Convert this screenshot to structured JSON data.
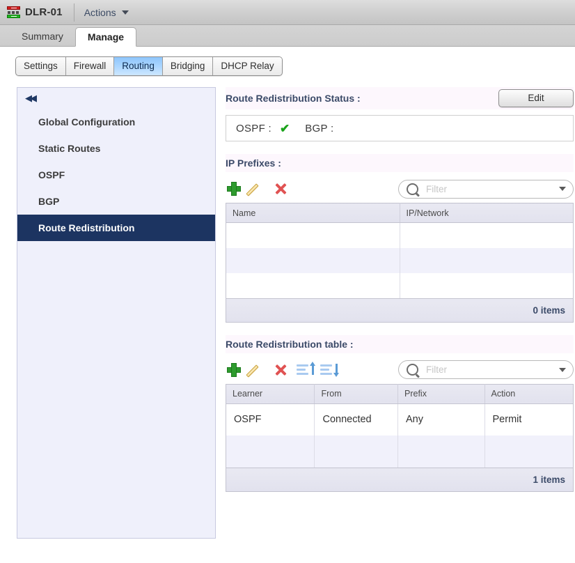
{
  "object_bar": {
    "icon": "router-device-icon",
    "title": "DLR-01",
    "actions_label": "Actions"
  },
  "main_tabs": [
    {
      "label": "Summary",
      "active": false
    },
    {
      "label": "Manage",
      "active": true
    }
  ],
  "sub_tabs": [
    {
      "label": "Settings",
      "active": false
    },
    {
      "label": "Firewall",
      "active": false
    },
    {
      "label": "Routing",
      "active": true
    },
    {
      "label": "Bridging",
      "active": false
    },
    {
      "label": "DHCP Relay",
      "active": false
    }
  ],
  "sidebar": {
    "collapse_icon": "double-chevron-left-icon",
    "items": [
      {
        "label": "Global Configuration",
        "selected": false
      },
      {
        "label": "Static Routes",
        "selected": false
      },
      {
        "label": "OSPF",
        "selected": false
      },
      {
        "label": "BGP",
        "selected": false
      },
      {
        "label": "Route Redistribution",
        "selected": true
      }
    ]
  },
  "status_section": {
    "title": "Route Redistribution Status :",
    "edit_label": "Edit",
    "ospf_label": "OSPF :",
    "ospf_enabled_icon": "green-check-icon",
    "bgp_label": "BGP :",
    "bgp_value": ""
  },
  "ip_prefixes": {
    "title": "IP Prefixes :",
    "toolbar": {
      "add": "add-icon",
      "edit": "edit-pencil-icon",
      "delete": "delete-x-icon"
    },
    "filter_placeholder": "Filter",
    "filter_value": "",
    "columns": [
      "Name",
      "IP/Network"
    ],
    "rows": [],
    "empty_row_count": 3,
    "footer": "0 items"
  },
  "redistribution_table": {
    "title": "Route Redistribution table :",
    "toolbar": {
      "add": "add-icon",
      "edit": "edit-pencil-icon",
      "delete": "delete-x-icon",
      "move_up": "move-up-icon",
      "move_down": "move-down-icon"
    },
    "filter_placeholder": "Filter",
    "filter_value": "",
    "columns": [
      "Learner",
      "From",
      "Prefix",
      "Action"
    ],
    "rows": [
      {
        "learner": "OSPF",
        "from": "Connected",
        "prefix": "Any",
        "action": "Permit"
      }
    ],
    "empty_row_count": 1,
    "footer": "1 items"
  },
  "colors": {
    "accent_selected_nav": "#1c3461",
    "accent_tab_active": "#8ec5fb",
    "status_ok": "#1aa31a",
    "section_title": "#3b4a68"
  }
}
